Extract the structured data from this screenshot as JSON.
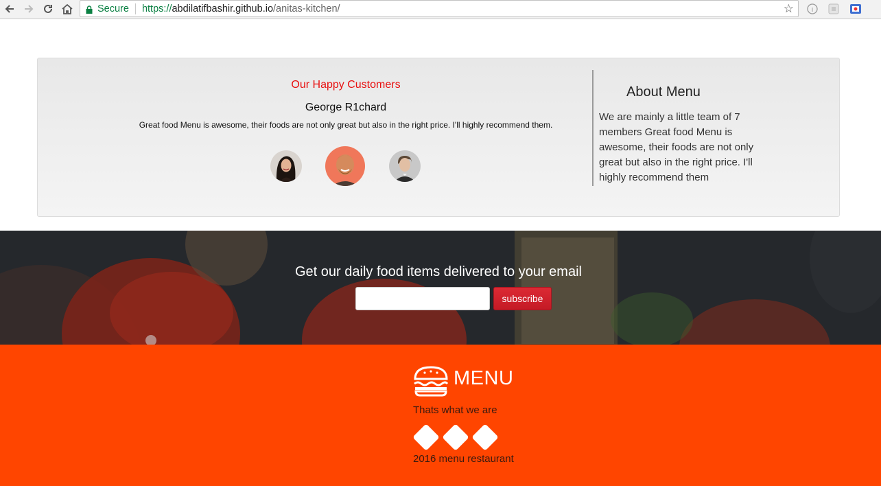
{
  "browser": {
    "secure_label": "Secure",
    "url_scheme": "https://",
    "url_host": "abdilatifbashir.github.io",
    "url_path": "/anitas-kitchen/"
  },
  "customers": {
    "title": "Our Happy Customers",
    "name": "George R1chard",
    "quote": "Great food Menu is awesome, their foods are not only great but also in the right price. I'll highly recommend them."
  },
  "about": {
    "title": "About Menu",
    "text": "We are mainly a little team of 7 members Great food Menu is awesome, their foods are not only great but also in the right price. I'll highly recommend them"
  },
  "newsletter": {
    "title": "Get our daily food items delivered to your email",
    "email_value": "",
    "subscribe_label": "subscribe"
  },
  "footer": {
    "brand": "MENU",
    "tagline": "Thats what we are",
    "copyright": "2016 menu restaurant"
  },
  "colors": {
    "accent_red": "#e81010",
    "footer_orange": "#ff4500",
    "subscribe_red": "#d0202b"
  }
}
